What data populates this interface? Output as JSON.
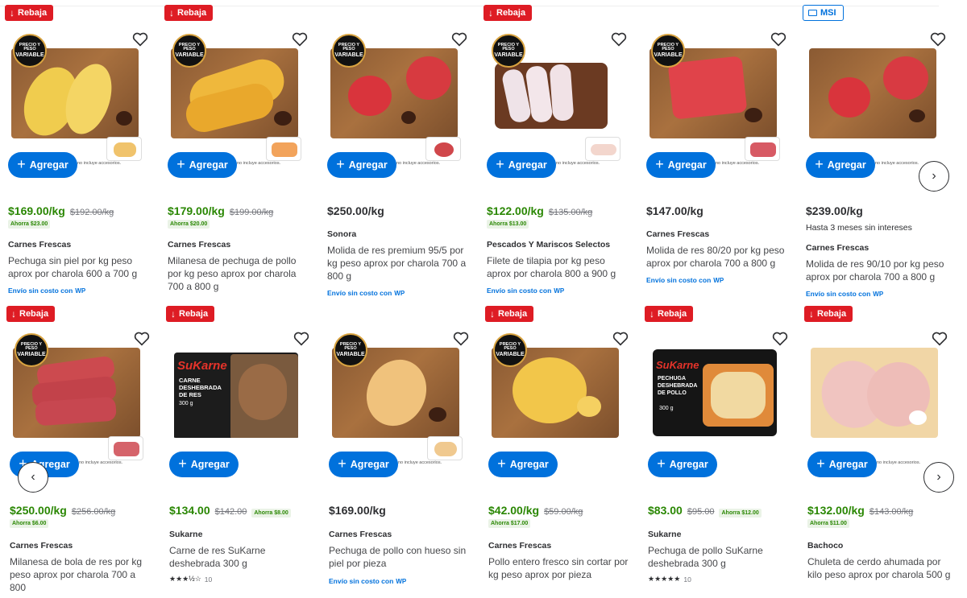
{
  "common": {
    "add_label": "Agregar",
    "no_accessories": "no incluye accesorios.",
    "variable_line1": "PRECIO Y PESO",
    "variable_line2": "VARIABLE",
    "envio_label": "Envío sin costo con",
    "wp_label": "WP"
  },
  "row1": [
    {
      "badge": "Rebaja",
      "price": "$169.00/kg",
      "was": "$192.00/kg",
      "ahorra": "Ahorra $23.00",
      "brand": "Carnes Frescas",
      "title": "Pechuga sin piel por kg peso aprox por charola 600 a 700 g",
      "envio": true
    },
    {
      "badge": "Rebaja",
      "price": "$179.00/kg",
      "was": "$199.00/kg",
      "ahorra": "Ahorra $20.00",
      "brand": "Carnes Frescas",
      "title": "Milanesa de pechuga de pollo por kg peso aprox por charola 700 a 800 g"
    },
    {
      "price": "$250.00/kg",
      "brand": "Sonora",
      "title": "Molida de res premium 95/5 por kg peso aprox por charola 700 a 800 g",
      "envio": true
    },
    {
      "badge": "Rebaja",
      "price": "$122.00/kg",
      "was": "$135.00/kg",
      "ahorra": "Ahorra $13.00",
      "brand": "Pescados Y Mariscos Selectos",
      "title": "Filete de tilapia por kg peso aprox por charola 800 a 900 g",
      "envio": true
    },
    {
      "price": "$147.00/kg",
      "brand": "Carnes Frescas",
      "title": "Molida de res 80/20 por kg peso aprox por charola 700 a 800 g",
      "envio": true
    },
    {
      "badge_msi": "MSI",
      "price": "$239.00/kg",
      "msi_text": "Hasta 3 meses sin intereses",
      "brand": "Carnes Frescas",
      "title": "Molida de res 90/10 por kg peso aprox por charola 700 a 800 g",
      "envio": true
    }
  ],
  "row2": [
    {
      "badge": "Rebaja",
      "price": "$250.00/kg",
      "was": "$256.00/kg",
      "ahorra": "Ahorra $6.00",
      "brand": "Carnes Frescas",
      "title": "Milanesa de bola de res por kg peso aprox por charola 700 a 800"
    },
    {
      "badge": "Rebaja",
      "price": "$134.00",
      "was": "$142.00",
      "ahorra": "Ahorra $8.00",
      "brand": "Sukarne",
      "title": "Carne de res SuKarne deshebrada 300 g",
      "stars": "★★★½☆",
      "reviews": "10"
    },
    {
      "price": "$169.00/kg",
      "brand": "Carnes Frescas",
      "title": "Pechuga de pollo con hueso sin piel por pieza",
      "envio": true
    },
    {
      "badge": "Rebaja",
      "price": "$42.00/kg",
      "was": "$59.00/kg",
      "ahorra": "Ahorra $17.00",
      "brand": "Carnes Frescas",
      "title": "Pollo entero fresco sin cortar por kg peso aprox por pieza"
    },
    {
      "badge": "Rebaja",
      "price": "$83.00",
      "was": "$95.00",
      "ahorra": "Ahorra $12.00",
      "brand": "Sukarne",
      "title": "Pechuga de pollo SuKarne deshebrada 300 g",
      "stars": "★★★★★",
      "reviews": "10"
    },
    {
      "badge": "Rebaja",
      "price": "$132.00/kg",
      "was": "$143.00/kg",
      "ahorra": "Ahorra $11.00",
      "brand": "Bachoco",
      "title": "Chuleta de cerdo ahumada por kilo peso aprox por charola 500 g"
    }
  ],
  "packaging": {
    "sukarne_logo": "SuKarne",
    "sukarne_beef_label": "CARNE DESHEBRADA DE RES",
    "sukarne_chicken_label": "PECHUGA DESHEBRADA DE POLLO",
    "weight": "300 g"
  },
  "colors": {
    "sale_green": "#2a8703",
    "rebaja_red": "#de1c24",
    "walmart_blue": "#0071dc"
  }
}
